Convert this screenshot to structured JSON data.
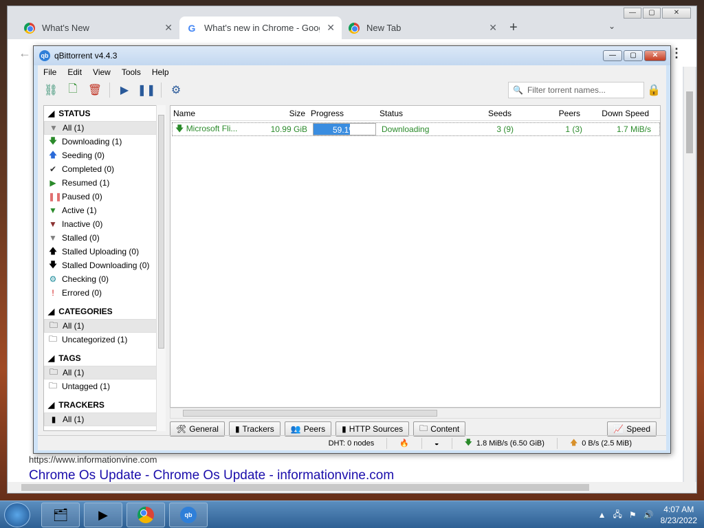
{
  "chrome": {
    "tabs": [
      {
        "title": "What's New",
        "icon": "chrome-icon"
      },
      {
        "title": "What's new in Chrome - Google",
        "icon": "google-icon"
      },
      {
        "title": "New Tab",
        "icon": "chrome-icon"
      }
    ],
    "page_url": "https://www.informationvine.com",
    "page_link": "Chrome Os Update - Chrome Os Update - informationvine.com"
  },
  "qb": {
    "title": "qBittorrent v4.4.3",
    "menu": [
      "File",
      "Edit",
      "View",
      "Tools",
      "Help"
    ],
    "filter_placeholder": "Filter torrent names...",
    "sidebar": {
      "status_header": "STATUS",
      "status_items": [
        {
          "label": "All (1)",
          "icon": "filter-icon",
          "color": "#808080"
        },
        {
          "label": "Downloading (1)",
          "icon": "download-arrow-icon",
          "color": "#2a8a2a"
        },
        {
          "label": "Seeding (0)",
          "icon": "upload-arrow-icon",
          "color": "#2a6ad8"
        },
        {
          "label": "Completed (0)",
          "icon": "check-icon",
          "color": "#333333"
        },
        {
          "label": "Resumed (1)",
          "icon": "play-icon",
          "color": "#2a8a2a"
        },
        {
          "label": "Paused (0)",
          "icon": "pause-icon",
          "color": "#e07070"
        },
        {
          "label": "Active (1)",
          "icon": "filter-icon",
          "color": "#2a8a2a"
        },
        {
          "label": "Inactive (0)",
          "icon": "filter-icon",
          "color": "#8a3030"
        },
        {
          "label": "Stalled (0)",
          "icon": "filter-icon",
          "color": "#808080"
        },
        {
          "label": "Stalled Uploading (0)",
          "icon": "upload-arrow-icon",
          "color": "#000000"
        },
        {
          "label": "Stalled Downloading (0)",
          "icon": "download-arrow-icon",
          "color": "#000000"
        },
        {
          "label": "Checking (0)",
          "icon": "gear-icon",
          "color": "#1a8a9a"
        },
        {
          "label": "Errored (0)",
          "icon": "exclamation-icon",
          "color": "#d01010"
        }
      ],
      "categories_header": "CATEGORIES",
      "categories_items": [
        {
          "label": "All (1)"
        },
        {
          "label": "Uncategorized (1)"
        }
      ],
      "tags_header": "TAGS",
      "tags_items": [
        {
          "label": "All (1)"
        },
        {
          "label": "Untagged (1)"
        }
      ],
      "trackers_header": "TRACKERS",
      "trackers_items": [
        {
          "label": "All (1)"
        }
      ]
    },
    "columns": [
      "Name",
      "Size",
      "Progress",
      "Status",
      "Seeds",
      "Peers",
      "Down Speed"
    ],
    "torrent": {
      "name": "Microsoft Fli...",
      "size": "10.99 GiB",
      "progress_text": "59.1%",
      "progress": 0.591,
      "status": "Downloading",
      "seeds": "3 (9)",
      "peers": "1 (3)",
      "down_speed": "1.7 MiB/s"
    },
    "bottom_tabs": [
      "General",
      "Trackers",
      "Peers",
      "HTTP Sources",
      "Content"
    ],
    "speed_label": "Speed",
    "statusbar": {
      "dht": "DHT: 0 nodes",
      "down": "1.8 MiB/s (6.50 GiB)",
      "up": "0 B/s (2.5 MiB)"
    }
  },
  "taskbar": {
    "time": "4:07 AM",
    "date": "8/23/2022"
  }
}
